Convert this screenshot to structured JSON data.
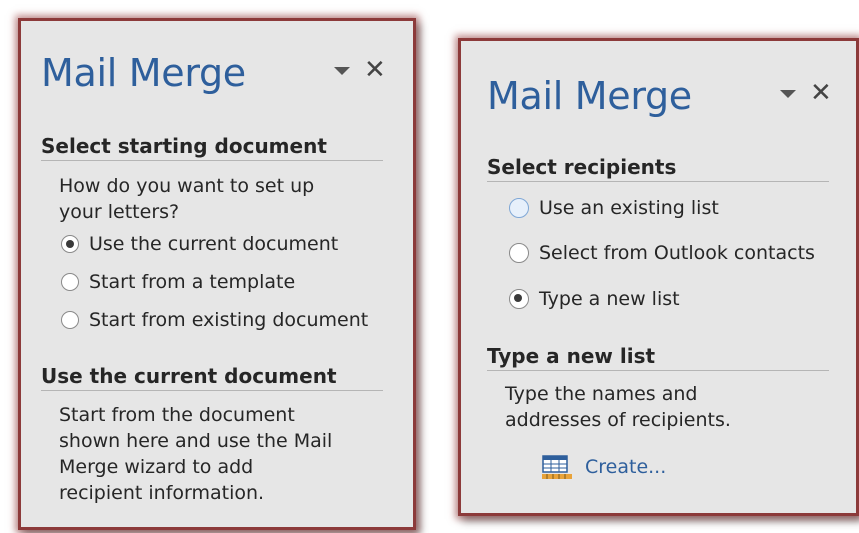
{
  "left_pane": {
    "title": "Mail Merge",
    "section1_heading": "Select starting document",
    "prompt_line1": "How do you want to set up",
    "prompt_line2": "your letters?",
    "options": [
      {
        "label": "Use the current document",
        "checked": true
      },
      {
        "label": "Start from a template",
        "checked": false
      },
      {
        "label": "Start from existing document",
        "checked": false
      }
    ],
    "section2_heading": "Use the current document",
    "desc_lines": [
      "Start from the document",
      "shown here and use the Mail",
      "Merge wizard to add",
      "recipient information."
    ]
  },
  "right_pane": {
    "title": "Mail Merge",
    "section1_heading": "Select recipients",
    "options": [
      {
        "label": "Use an existing list",
        "checked": false
      },
      {
        "label": "Select from Outlook contacts",
        "checked": false
      },
      {
        "label": "Type a new list",
        "checked": true
      }
    ],
    "section2_heading": "Type a new list",
    "desc_lines": [
      "Type the names and",
      "addresses of recipients."
    ],
    "create_link": "Create...",
    "icons": {
      "dropdown": "dropdown-arrow-icon",
      "close": "close-icon",
      "create": "table-edit-icon"
    }
  },
  "colors": {
    "title": "#2e5f9c",
    "border": "#8c3a3a",
    "background": "#e6e6e6"
  }
}
